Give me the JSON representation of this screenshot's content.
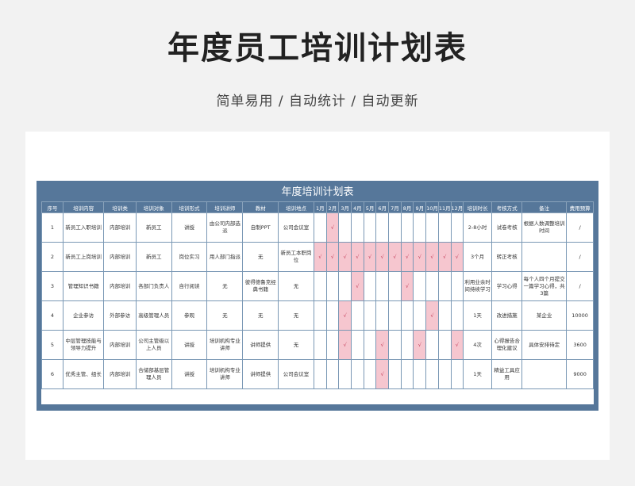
{
  "hero": {
    "title": "年度员工培训计划表",
    "subtitle": "简单易用 / 自动统计 / 自动更新"
  },
  "table": {
    "title": "年度培训计划表",
    "headers": [
      "序号",
      "培训内容",
      "培训类",
      "培训对象",
      "培训形式",
      "培训讲师",
      "教材",
      "培训地点",
      "1月",
      "2月",
      "3月",
      "4月",
      "5月",
      "6月",
      "7月",
      "8月",
      "9月",
      "10月",
      "11月",
      "12月",
      "培训时长",
      "考核方式",
      "备注",
      "费用预算"
    ],
    "rows": [
      [
        "1",
        "新员工入职培训",
        "内部培训",
        "新员工",
        "讲授",
        "由公司内部选派",
        "自制PPT",
        "公司会议室",
        "",
        "√",
        "",
        "",
        "",
        "",
        "",
        "",
        "",
        "",
        "",
        "",
        "2-8小时",
        "试卷考核",
        "根据人数调整培训时间",
        "/"
      ],
      [
        "2",
        "新员工上岗培训",
        "内部培训",
        "新员工",
        "岗位实习",
        "用人部门指派",
        "无",
        "新员工本职岗位",
        "√",
        "√",
        "√",
        "√",
        "√",
        "√",
        "√",
        "√",
        "√",
        "√",
        "√",
        "√",
        "3个月",
        "转正考核",
        "",
        "/"
      ],
      [
        "3",
        "管理知识书籍",
        "内部培训",
        "各部门负责人",
        "自行阅读",
        "无",
        "彼得德鲁克经典书籍",
        "无",
        "",
        "",
        "",
        "√",
        "",
        "",
        "",
        "√",
        "",
        "",
        "",
        "",
        "利用业余时间持续学习",
        "学习心得",
        "每个人四个月提交一篇学习心得，共3篇",
        "/"
      ],
      [
        "4",
        "企业参访",
        "外部参访",
        "高级管理人员",
        "参观",
        "无",
        "无",
        "无",
        "",
        "",
        "√",
        "",
        "",
        "",
        "",
        "",
        "",
        "√",
        "",
        "",
        "1天",
        "改进措施",
        "某企业",
        "10000"
      ],
      [
        "5",
        "中层管理技能与领导力提升",
        "内部培训",
        "公司主管级以上人员",
        "讲授",
        "培训机构专业讲师",
        "讲师提供",
        "无",
        "",
        "",
        "√",
        "",
        "",
        "√",
        "",
        "",
        "√",
        "",
        "",
        "√",
        "4次",
        "心得报告合理化建议",
        "具体安排待定",
        "3600"
      ],
      [
        "6",
        "优秀主管、组长",
        "内部培训",
        "合储部基层管理人员",
        "讲授",
        "培训机构专业讲师",
        "讲师提供",
        "公司会议室",
        "",
        "",
        "",
        "",
        "",
        "√",
        "",
        "",
        "",
        "",
        "",
        "",
        "1天",
        "精益工具应用",
        "",
        "9000"
      ]
    ]
  },
  "colors": {
    "header_bg": "#56779a",
    "highlight": "#f6c6cf",
    "check": "#c23a56"
  }
}
